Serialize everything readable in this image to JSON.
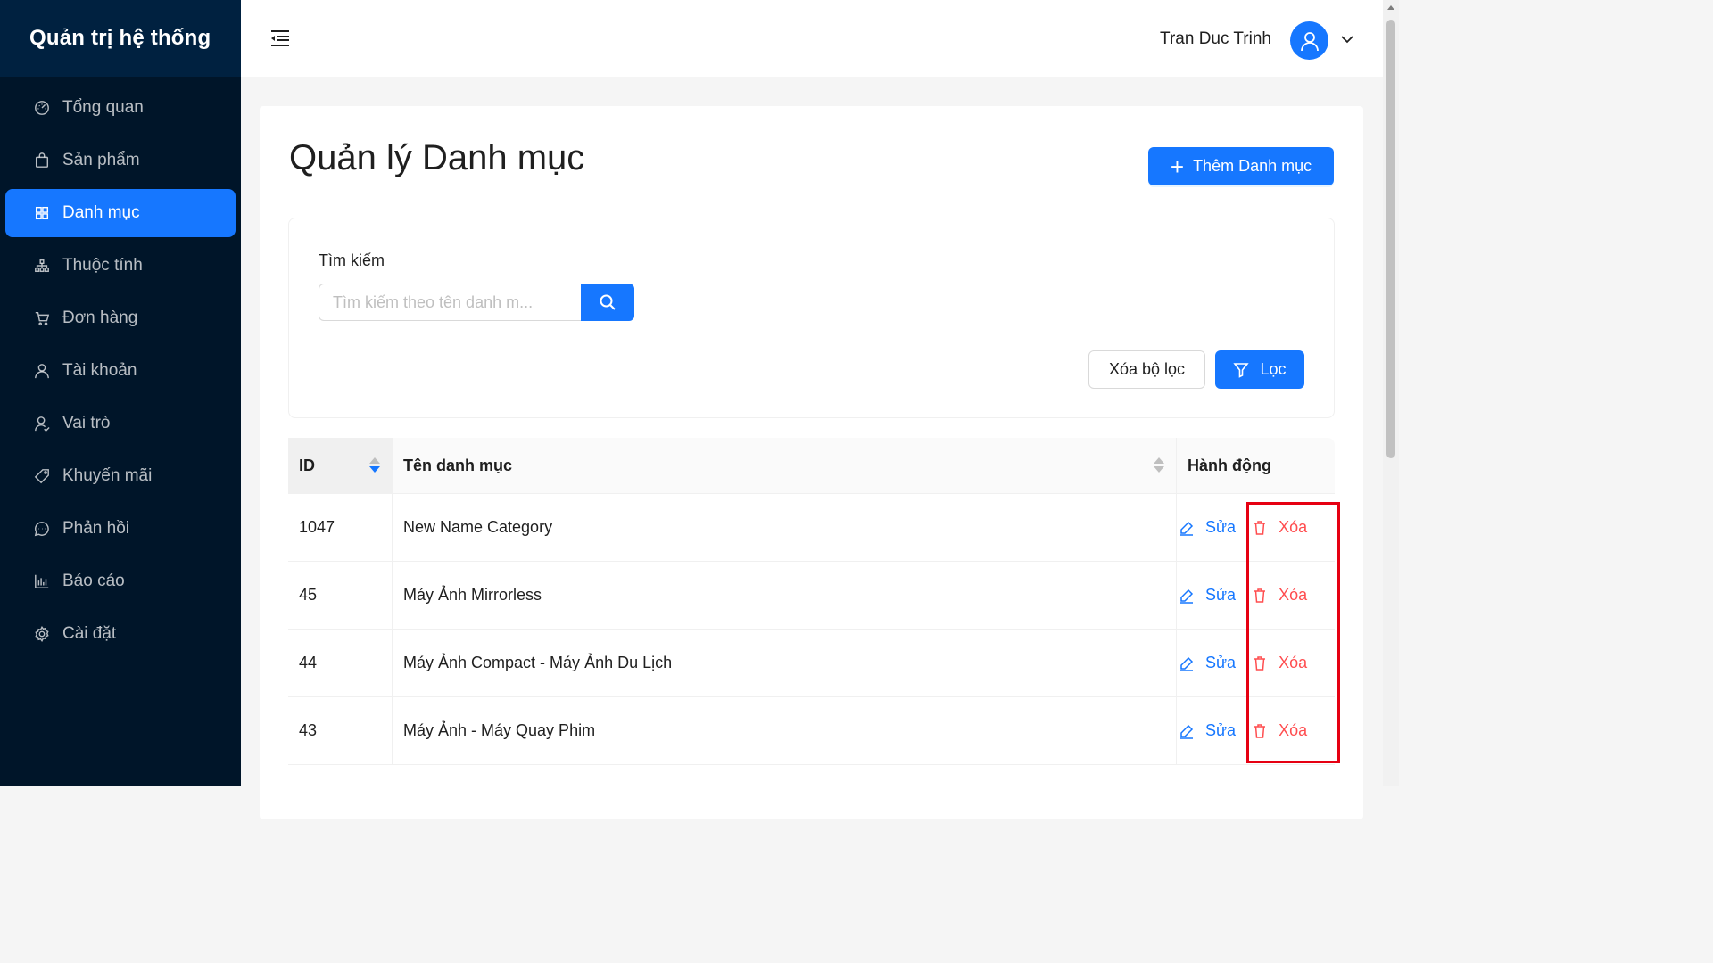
{
  "app": {
    "brand": "Quản trị hệ thống"
  },
  "sidebar": {
    "items": [
      {
        "label": "Tổng quan",
        "icon": "dashboard-icon",
        "active": false
      },
      {
        "label": "Sản phẩm",
        "icon": "shopping-bag-icon",
        "active": false
      },
      {
        "label": "Danh mục",
        "icon": "appstore-icon",
        "active": true
      },
      {
        "label": "Thuộc tính",
        "icon": "cluster-icon",
        "active": false
      },
      {
        "label": "Đơn hàng",
        "icon": "shopping-cart-icon",
        "active": false
      },
      {
        "label": "Tài khoản",
        "icon": "user-icon",
        "active": false
      },
      {
        "label": "Vai trò",
        "icon": "team-icon",
        "active": false
      },
      {
        "label": "Khuyến mãi",
        "icon": "tag-icon",
        "active": false
      },
      {
        "label": "Phản hồi",
        "icon": "comment-icon",
        "active": false
      },
      {
        "label": "Báo cáo",
        "icon": "bar-chart-icon",
        "active": false
      },
      {
        "label": "Cài đặt",
        "icon": "setting-icon",
        "active": false
      }
    ]
  },
  "header": {
    "user_name": "Tran Duc Trinh"
  },
  "page": {
    "title": "Quản lý Danh mục",
    "add_button": "Thêm Danh mục"
  },
  "filter": {
    "label": "Tìm kiếm",
    "search_placeholder": "Tìm kiếm theo tên danh m...",
    "clear_button": "Xóa bộ lọc",
    "filter_button": "Lọc"
  },
  "table": {
    "columns": {
      "id": "ID",
      "name": "Tên danh mục",
      "actions": "Hành động"
    },
    "edit_label": "Sửa",
    "delete_label": "Xóa",
    "rows": [
      {
        "id": "1047",
        "name": "New Name Category"
      },
      {
        "id": "45",
        "name": "Máy Ảnh Mirrorless"
      },
      {
        "id": "44",
        "name": "Máy Ảnh Compact - Máy Ảnh Du Lịch"
      },
      {
        "id": "43",
        "name": "Máy Ảnh - Máy Quay Phim"
      }
    ]
  },
  "colors": {
    "primary": "#1677ff",
    "danger": "#ff4d4f",
    "sidebar_bg": "#001529",
    "highlight": "#e60012"
  }
}
